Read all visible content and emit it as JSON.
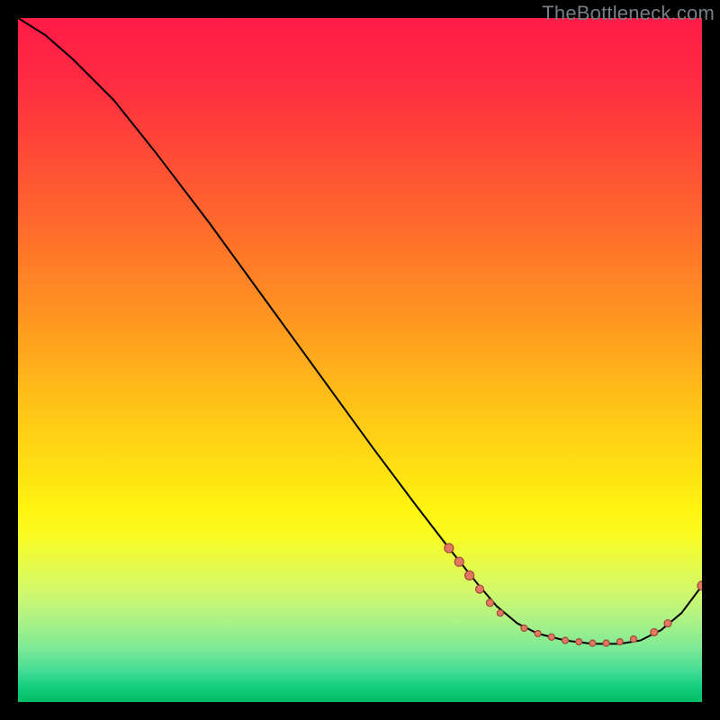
{
  "watermark": "TheBottleneck.com",
  "gradient_stops": [
    {
      "offset": 0.0,
      "color": "#ff1b47"
    },
    {
      "offset": 0.09,
      "color": "#ff2b42"
    },
    {
      "offset": 0.2,
      "color": "#ff4a36"
    },
    {
      "offset": 0.32,
      "color": "#ff6f2a"
    },
    {
      "offset": 0.44,
      "color": "#ff9620"
    },
    {
      "offset": 0.55,
      "color": "#ffbd18"
    },
    {
      "offset": 0.66,
      "color": "#ffe012"
    },
    {
      "offset": 0.72,
      "color": "#fff410"
    },
    {
      "offset": 0.76,
      "color": "#f8fb24"
    },
    {
      "offset": 0.8,
      "color": "#e6fb4a"
    },
    {
      "offset": 0.84,
      "color": "#d0f86c"
    },
    {
      "offset": 0.88,
      "color": "#aef286"
    },
    {
      "offset": 0.92,
      "color": "#7eea95"
    },
    {
      "offset": 0.955,
      "color": "#44dd95"
    },
    {
      "offset": 0.975,
      "color": "#16cf81"
    },
    {
      "offset": 1.0,
      "color": "#00bd64"
    }
  ],
  "marker_style": {
    "fill": "#e17862",
    "stroke": "#a24a3b",
    "stroke_width": 1.2
  },
  "curve_style": {
    "stroke": "#000000",
    "stroke_width": 2
  },
  "chart_data": {
    "type": "line",
    "title": "",
    "xlabel": "",
    "ylabel": "",
    "xlim": [
      0,
      100
    ],
    "ylim": [
      0,
      100
    ],
    "grid": false,
    "legend": false,
    "annotations": [
      "TheBottleneck.com"
    ],
    "notes": "Axes unlabeled in source image; x and y in 0–100 units inferred from plot extent. Curve shows a steep monotone descent with a flat trough near the right edge and a small uptick at the far right. Markers cluster on the descending lip, the trough, and the final uptick.",
    "series": [
      {
        "name": "curve",
        "x": [
          0,
          4,
          8,
          14,
          20,
          28,
          36,
          44,
          52,
          58,
          63,
          67,
          70,
          73,
          76,
          80,
          84,
          88,
          91,
          94,
          97,
          100
        ],
        "y": [
          100,
          97.5,
          94,
          88,
          80.5,
          70,
          59,
          48,
          37,
          29,
          22.5,
          17.5,
          14,
          11.5,
          10,
          9,
          8.5,
          8.5,
          9,
          10.5,
          13,
          17
        ]
      }
    ],
    "markers": [
      {
        "x": 63,
        "y": 22.5,
        "r": 5
      },
      {
        "x": 64.5,
        "y": 20.5,
        "r": 5
      },
      {
        "x": 66,
        "y": 18.5,
        "r": 5
      },
      {
        "x": 67.5,
        "y": 16.5,
        "r": 4.5
      },
      {
        "x": 69,
        "y": 14.5,
        "r": 4
      },
      {
        "x": 70.5,
        "y": 13,
        "r": 3.5
      },
      {
        "x": 74,
        "y": 10.8,
        "r": 3.5
      },
      {
        "x": 76,
        "y": 10.0,
        "r": 3.5
      },
      {
        "x": 78,
        "y": 9.5,
        "r": 3.5
      },
      {
        "x": 80,
        "y": 9.0,
        "r": 3.5
      },
      {
        "x": 82,
        "y": 8.8,
        "r": 3.5
      },
      {
        "x": 84,
        "y": 8.6,
        "r": 3.5
      },
      {
        "x": 86,
        "y": 8.6,
        "r": 3.5
      },
      {
        "x": 88,
        "y": 8.8,
        "r": 3.5
      },
      {
        "x": 90,
        "y": 9.2,
        "r": 3.5
      },
      {
        "x": 93,
        "y": 10.2,
        "r": 4
      },
      {
        "x": 95,
        "y": 11.5,
        "r": 4
      },
      {
        "x": 100,
        "y": 17,
        "r": 5
      }
    ]
  }
}
